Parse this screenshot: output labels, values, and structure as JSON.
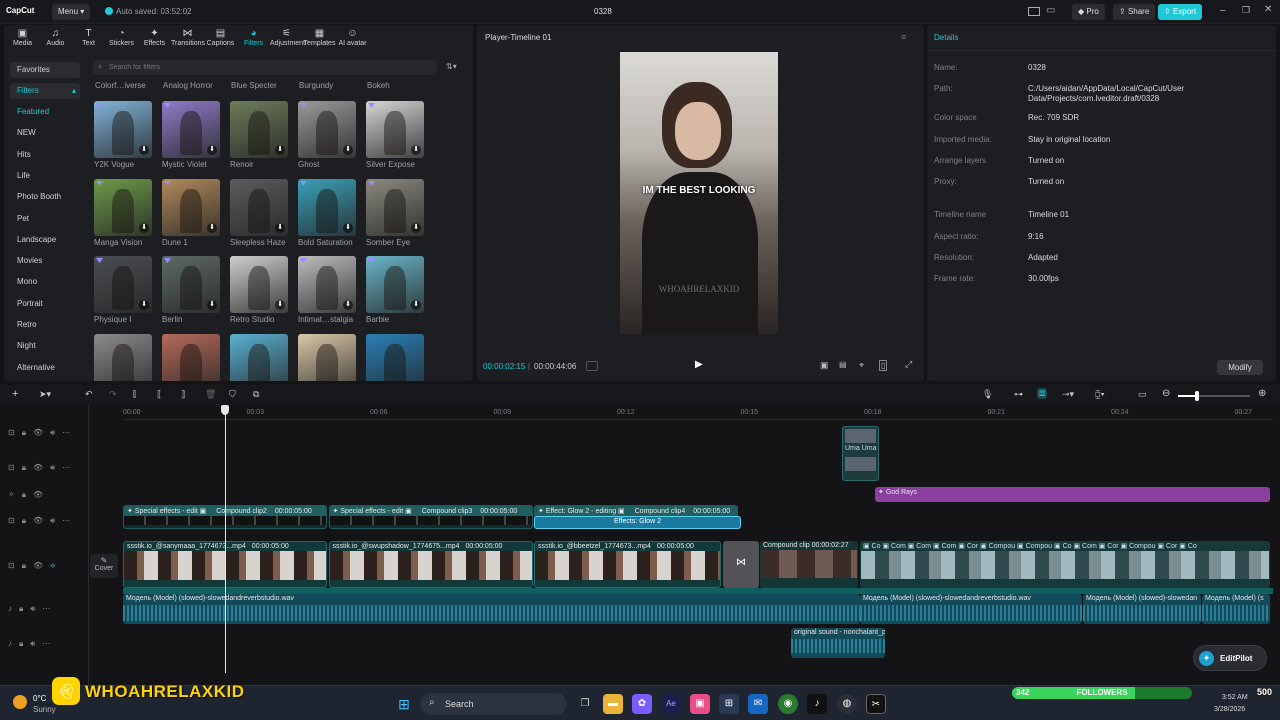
{
  "titlebar": {
    "app_name": "CapCut",
    "menu_label": "Menu",
    "autosave": "Auto saved: 03:52:02",
    "project_title": "0328",
    "pro_label": "Pro",
    "share_label": "Share",
    "export_label": "Export"
  },
  "toolbar": {
    "items": [
      {
        "label": "Media",
        "icon": "media-icon"
      },
      {
        "label": "Audio",
        "icon": "audio-icon"
      },
      {
        "label": "Text",
        "icon": "text-icon"
      },
      {
        "label": "Stickers",
        "icon": "stickers-icon"
      },
      {
        "label": "Effects",
        "icon": "effects-icon"
      },
      {
        "label": "Transitions",
        "icon": "transitions-icon"
      },
      {
        "label": "Captions",
        "icon": "captions-icon"
      },
      {
        "label": "Filters",
        "icon": "filters-icon"
      },
      {
        "label": "Adjustment",
        "icon": "adjustment-icon"
      },
      {
        "label": "Templates",
        "icon": "templates-icon"
      },
      {
        "label": "AI avatar",
        "icon": "ai-avatar-icon"
      }
    ],
    "active": "Filters"
  },
  "sidebar": {
    "favorites": "Favorites",
    "filters": "Filters",
    "items": [
      "Featured",
      "NEW",
      "Hits",
      "Life",
      "Photo Booth",
      "Pet",
      "Landscape",
      "Movies",
      "Mono",
      "Portrait",
      "Retro",
      "Night",
      "Alternative"
    ]
  },
  "filters_panel": {
    "search_placeholder": "Search for filters",
    "top_row": [
      "Colorf…iverse",
      "Analog Horror",
      "Blue Specter",
      "Burgundy",
      "Bokeh"
    ],
    "rows": [
      [
        {
          "name": "Y2K Vogue",
          "color": "#7fb4d8"
        },
        {
          "name": "Mystic Violet",
          "color": "#8f7cc8"
        },
        {
          "name": "Renoir",
          "color": "#6d7c5a"
        },
        {
          "name": "Ghost",
          "color": "#9a9a9a"
        },
        {
          "name": "Silver Expose",
          "color": "#d6d6d6"
        }
      ],
      [
        {
          "name": "Manga Vision",
          "color": "#6d9a4a"
        },
        {
          "name": "Dune 1",
          "color": "#b18a5c"
        },
        {
          "name": "Sleepless Haze",
          "color": "#5c5c5c"
        },
        {
          "name": "Bold Saturation",
          "color": "#3aa0b8"
        },
        {
          "name": "Somber Eye",
          "color": "#8a8a80"
        }
      ],
      [
        {
          "name": "Physique Ⅰ",
          "color": "#4b4e52"
        },
        {
          "name": "Berlin",
          "color": "#5d6a66"
        },
        {
          "name": "Retro Studio",
          "color": "#cfcfcf"
        },
        {
          "name": "Intimat…stalgia",
          "color": "#bdbdbd"
        },
        {
          "name": "Barbie",
          "color": "#6ab5c8"
        }
      ],
      [
        {
          "name": "",
          "color": "#8b8b8b"
        },
        {
          "name": "",
          "color": "#b46a5a"
        },
        {
          "name": "",
          "color": "#5ab0d0"
        },
        {
          "name": "",
          "color": "#d9c8a8"
        },
        {
          "name": "",
          "color": "#2a7fb5"
        }
      ]
    ]
  },
  "player": {
    "title": "Player-Timeline 01",
    "caption": "IM THE BEST LOOKING",
    "watermark": "WHOAHRELAXKID",
    "current_time": "00:00:02:15",
    "total_time": "00:00:44:06"
  },
  "details": {
    "title": "Details",
    "rows": [
      {
        "k": "Name:",
        "v": "0328"
      },
      {
        "k": "Path:",
        "v": "C:/Users/aidan/AppData/Local/CapCut/User Data/Projects/com.lveditor.draft/0328"
      },
      {
        "k": "Color space",
        "v": "Rec. 709 SDR"
      },
      {
        "k": "Imported media:",
        "v": "Stay in original location"
      },
      {
        "k": "Arrange layers",
        "v": "Turned on"
      },
      {
        "k": "Proxy:",
        "v": "Turned on"
      },
      {
        "k": "Timeline name",
        "v": "Timeline 01"
      },
      {
        "k": "Aspect ratio:",
        "v": "9:16"
      },
      {
        "k": "Resolution:",
        "v": "Adapted"
      },
      {
        "k": "Frame rate:",
        "v": "30.00fps"
      }
    ],
    "modify_label": "Modify"
  },
  "timeline": {
    "ruler": [
      "00:00",
      "00:03",
      "00:06",
      "00:09",
      "00:12",
      "00:15",
      "00:18",
      "00:21",
      "00:24",
      "00:27"
    ],
    "cover_label": "Cover",
    "god_rays": "God Rays",
    "effect_clips": [
      {
        "label": "Special effects - edit",
        "sub": "Compound clip2",
        "dur": "00:00:05:00"
      },
      {
        "label": "Special effects - edit",
        "sub": "Compound clip3",
        "dur": "00:00:05:00"
      },
      {
        "label": "Effect: Glow 2 - editing",
        "sub": "Compound clip4",
        "dur": "00:00:05:00"
      }
    ],
    "glow_label": "Effects:  Glow 2",
    "video_clips": [
      {
        "label": "ssstik.io_@sanymaaa_1774673...mp4",
        "dur": "00:00:05:00"
      },
      {
        "label": "ssstik.io_@swupshadow_1774675...mp4",
        "dur": "00:00:05:00"
      },
      {
        "label": "ssstik.io_@bbeetzel_1774673...mp4",
        "dur": "00:00:05:00"
      }
    ],
    "compound_label": "Compound clip",
    "compound_dur": "00:00:02:27",
    "audio_main": "Модель (Model) (slowed)-slowedandreverbstudio.wav",
    "audio_mid": "Модель (Model) (slowed)-slowedandreverbstudio.wav",
    "audio_right": "Модель (Model) (slowed)-slowedan",
    "audio_far": "Модель (Model) (s",
    "original_sound": "original sound - nonchalant_pe",
    "editpilot": "EditPilot"
  },
  "taskbar": {
    "temp": "0°C",
    "weather": "Sunny",
    "search": "Search",
    "overlay_name": "WHOAHRELAXKID",
    "followers_count": "342",
    "followers_label": "FOLLOWERS",
    "followers_goal": "500",
    "time": "3:52 AM",
    "date": "3/28/2026"
  }
}
